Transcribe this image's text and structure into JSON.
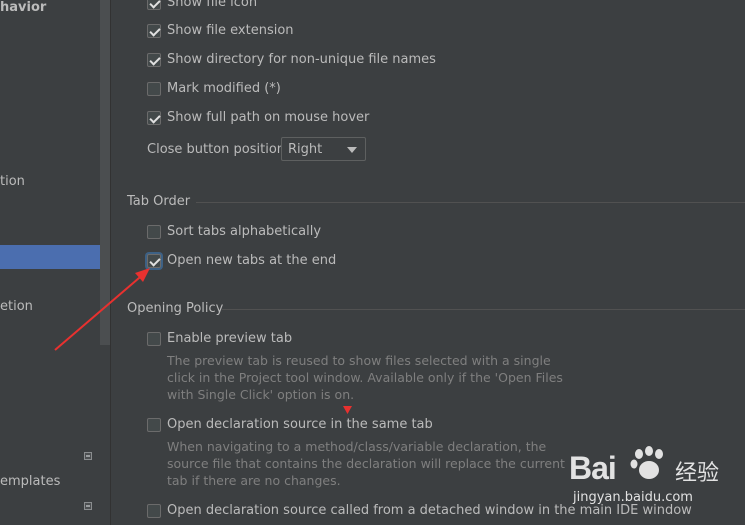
{
  "sidebar": {
    "items": [
      {
        "label": "havior",
        "bold": true
      },
      {
        "label": "tion"
      },
      {
        "label": "etion"
      },
      {
        "label": "emplates"
      }
    ]
  },
  "appearance": {
    "items": [
      {
        "label": "Show file icon",
        "checked": true
      },
      {
        "label": "Show file extension",
        "checked": true
      },
      {
        "label": "Show directory for non-unique file names",
        "checked": true
      },
      {
        "label": "Mark modified (*)",
        "checked": false
      },
      {
        "label": "Show full path on mouse hover",
        "checked": true
      }
    ],
    "close_button_label": "Close button position:",
    "close_button_value": "Right"
  },
  "tab_order": {
    "title": "Tab Order",
    "sort_label": "Sort tabs alphabetically",
    "sort_checked": false,
    "open_new_label": "Open new tabs at the end",
    "open_new_checked": true
  },
  "opening_policy": {
    "title": "Opening Policy",
    "preview_label": "Enable preview tab",
    "preview_desc": "The preview tab is reused to show files selected with a single click in the Project tool window. Available only if the 'Open Files with Single Click' option is on.",
    "declaration_label": "Open declaration source in the same tab",
    "declaration_desc": "When navigating to a method/class/variable declaration, the source file that contains the declaration will replace the current tab if there are no changes.",
    "detached_label": "Open declaration source called from a detached window in the main IDE window"
  },
  "watermark": {
    "brand": "Bai",
    "brand2": "经验",
    "url": "jingyan.baidu.com"
  },
  "colors": {
    "accent": "#4b6eaf",
    "annotation": "#e8312f"
  }
}
